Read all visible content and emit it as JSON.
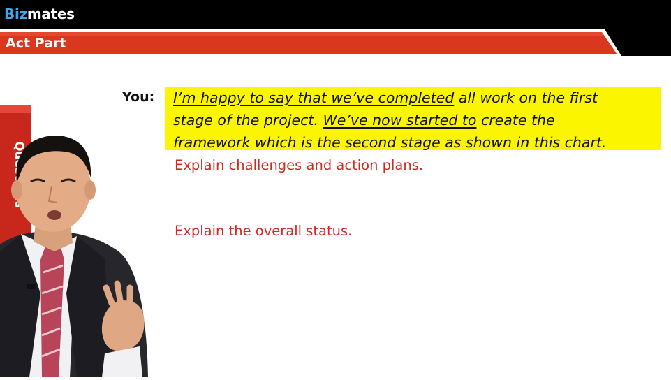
{
  "header": {
    "brand_prefix": "Biz",
    "brand_suffix": "mates",
    "section_title": "Act Part"
  },
  "colors": {
    "brand_blue": "#3ea7e8",
    "header_black": "#000000",
    "section_red": "#d9381e",
    "highlight_yellow": "#fbf500",
    "instruction_red": "#d12a20"
  },
  "dialogue": {
    "speaker": "You:",
    "line1_ul": "I’m happy to say that we’ve completed",
    "line1_rest": " all work on the first",
    "line2_a": "stage of the project. ",
    "line2_ul": "We’ve now started to",
    "line2_rest": " create the",
    "line3": "framework which is the second stage as shown in this chart."
  },
  "instructions": {
    "first": "Explain challenges and action plans.",
    "second": "Explain the overall status."
  },
  "presenter": {
    "banner_text": "Questions"
  }
}
